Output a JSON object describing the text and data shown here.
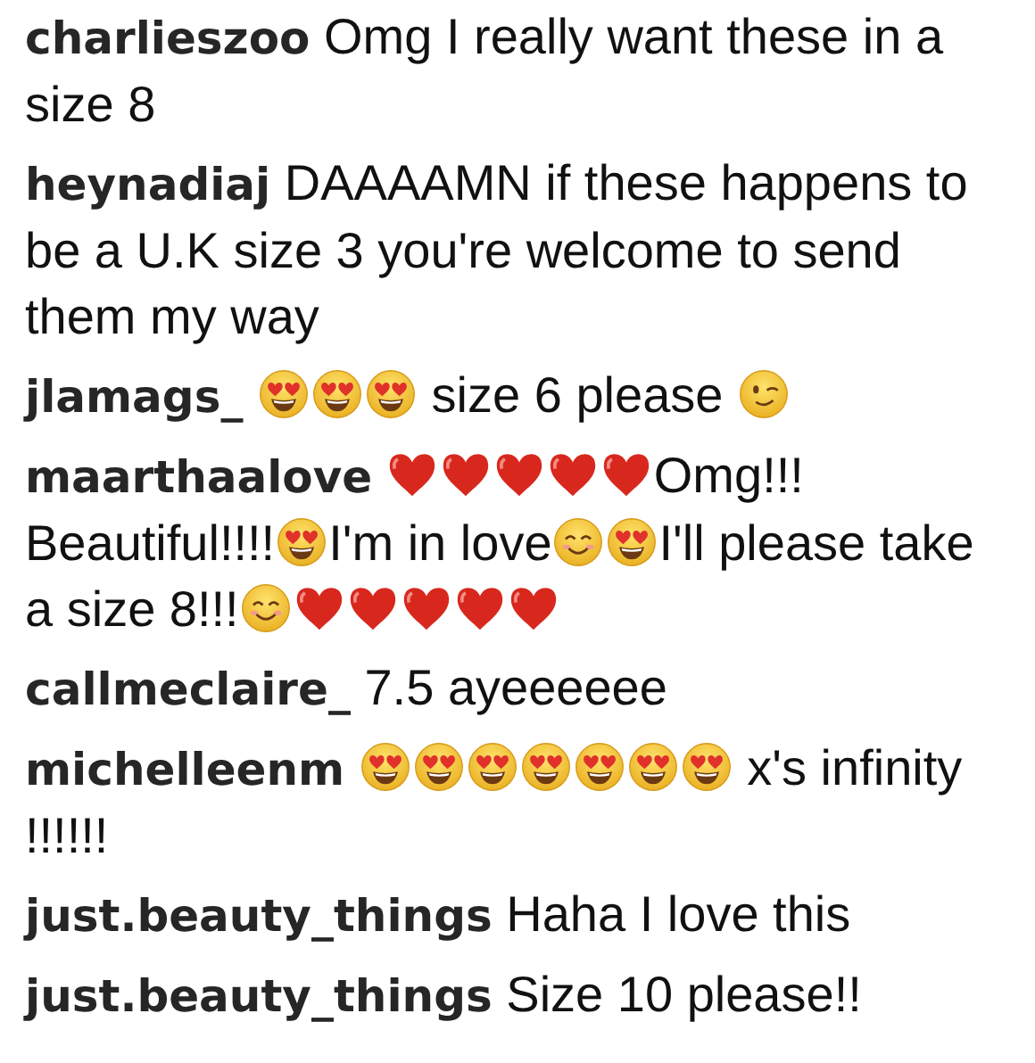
{
  "comments": [
    {
      "username": "charlieszoo",
      "parts": [
        {
          "kind": "text",
          "text": "Omg I really want these in a size 8"
        }
      ]
    },
    {
      "username": "heynadiaj",
      "parts": [
        {
          "kind": "text",
          "text": "DAAAAMN if these happens to be a U.K size 3 you're welcome to send them my way"
        }
      ]
    },
    {
      "username": "jlamags_",
      "parts": [
        {
          "kind": "heart_eyes"
        },
        {
          "kind": "heart_eyes"
        },
        {
          "kind": "heart_eyes"
        },
        {
          "kind": "text",
          "text": " size 6 please "
        },
        {
          "kind": "wink"
        }
      ]
    },
    {
      "username": "maarthaalove",
      "parts": [
        {
          "kind": "heart"
        },
        {
          "kind": "heart"
        },
        {
          "kind": "heart"
        },
        {
          "kind": "heart"
        },
        {
          "kind": "heart"
        },
        {
          "kind": "text",
          "text": "Omg!!! Beautiful!!!!"
        },
        {
          "kind": "heart_eyes"
        },
        {
          "kind": "text",
          "text": "I'm in love"
        },
        {
          "kind": "smile"
        },
        {
          "kind": "heart_eyes"
        },
        {
          "kind": "text",
          "text": "I'll please take a size 8!!!"
        },
        {
          "kind": "smile"
        },
        {
          "kind": "heart"
        },
        {
          "kind": "heart"
        },
        {
          "kind": "heart"
        },
        {
          "kind": "heart"
        },
        {
          "kind": "heart"
        }
      ]
    },
    {
      "username": "callmeclaire_",
      "parts": [
        {
          "kind": "text",
          "text": "7.5 ayeeeeee"
        }
      ]
    },
    {
      "username": "michelleenm",
      "parts": [
        {
          "kind": "heart_eyes"
        },
        {
          "kind": "heart_eyes"
        },
        {
          "kind": "heart_eyes"
        },
        {
          "kind": "heart_eyes"
        },
        {
          "kind": "heart_eyes"
        },
        {
          "kind": "heart_eyes"
        },
        {
          "kind": "heart_eyes"
        },
        {
          "kind": "text",
          "text": " x's infinity !!!!!!"
        }
      ]
    },
    {
      "username": "just.beauty_things",
      "parts": [
        {
          "kind": "text",
          "text": "Haha I love this"
        }
      ]
    },
    {
      "username": "just.beauty_things",
      "parts": [
        {
          "kind": "text",
          "text": "Size 10 please!!"
        }
      ]
    }
  ]
}
